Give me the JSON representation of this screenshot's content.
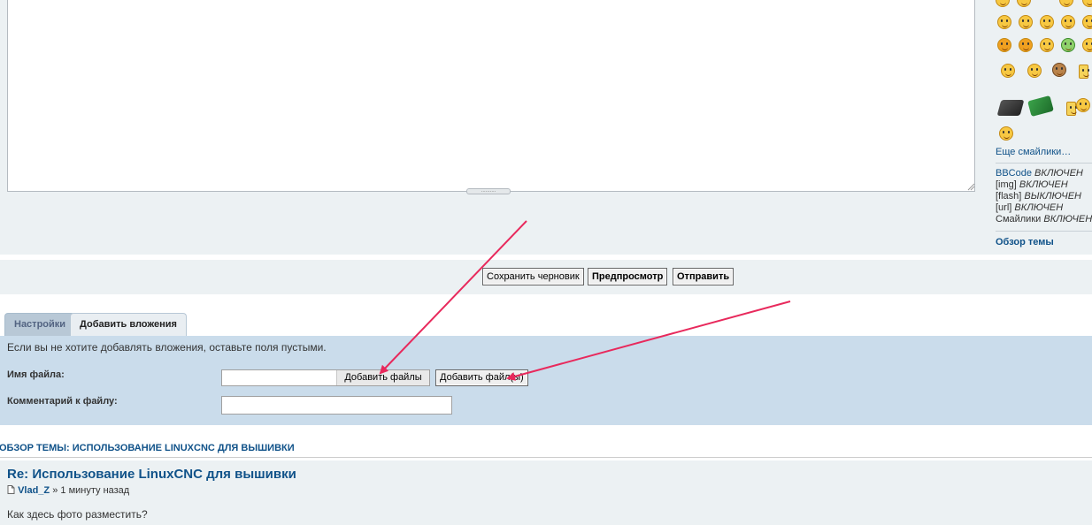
{
  "editor": {
    "grip_label": "..........",
    "message_value": ""
  },
  "smilies_panel": {
    "more_link": "Еще смайлики…",
    "icons": [
      "smiley-icon",
      "smiley-icon",
      "smiley-icon",
      "smiley-icon",
      "smiley-icon",
      "devil-smiley-icon",
      "devil-smiley-icon",
      "smiley-icon",
      "green-smiley-icon",
      "smiley-icon",
      "headphones-smiley-icon",
      "smiley-icon",
      "monkey-smiley-icon",
      "beer-smiley-icon",
      "hard-drive-icon",
      "circuit-board-icon",
      "beer-smiley-icon",
      "smiley-icon"
    ],
    "bbcode": [
      {
        "key": "BBCode",
        "status": "ВКЛЮЧЕН"
      },
      {
        "key": "[img]",
        "status": "ВКЛЮЧЕН"
      },
      {
        "key": "[flash]",
        "status": "ВЫКЛЮЧЕН"
      },
      {
        "key": "[url]",
        "status": "ВКЛЮЧЕН"
      },
      {
        "key": "Смайлики",
        "status": "ВКЛЮЧЕН"
      }
    ],
    "topic_review_link": "Обзор темы"
  },
  "actions": {
    "save_draft": "Сохранить черновик",
    "preview": "Предпросмотр",
    "submit": "Отправить"
  },
  "tabs": [
    {
      "label": "Настройки",
      "active": false
    },
    {
      "label": "Добавить вложения",
      "active": true
    }
  ],
  "attachments": {
    "note": "Если вы не хотите добавлять вложения, оставьте поля пустыми.",
    "filename_label": "Имя файла:",
    "choose_files": "Добавить файлы",
    "add_files_button": "Добавить файл(ы)",
    "comment_label": "Комментарий к файлу:",
    "comment_value": ""
  },
  "topic_review": {
    "header": "ОБЗОР ТЕМЫ: ИСПОЛЬЗОВАНИЕ LINUXCNC ДЛЯ ВЫШИВКИ",
    "post_title": "Re: Использование LinuxCNC для вышивки",
    "author": "Vlad_Z",
    "separator": "»",
    "time": "1 минуту назад",
    "body": "Как здесь фото разместить?"
  },
  "colors": {
    "link": "#105289",
    "panel": "#ecf1f3",
    "attach_panel": "#cadceb",
    "arrow": "#e8295c"
  }
}
